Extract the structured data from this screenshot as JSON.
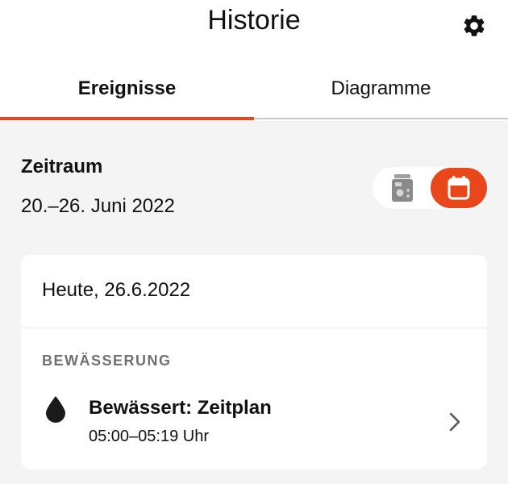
{
  "header": {
    "title": "Historie",
    "settings_icon": "gear-icon"
  },
  "tabs": [
    {
      "label": "Ereignisse",
      "active": true
    },
    {
      "label": "Diagramme",
      "active": false
    }
  ],
  "period": {
    "label": "Zeitraum",
    "range": "20.–26. Juni 2022",
    "toggle": {
      "options": [
        {
          "icon": "device-icon",
          "selected": false
        },
        {
          "icon": "calendar-icon",
          "selected": true
        }
      ]
    }
  },
  "day_card": {
    "date": "Heute, 26.6.2022",
    "section": "BEWÄSSERUNG",
    "event": {
      "icon": "water-drop-icon",
      "title": "Bewässert: Zeitplan",
      "time": "05:00–05:19 Uhr"
    }
  },
  "colors": {
    "accent": "#e8471b",
    "background": "#f4f4f4",
    "card": "#ffffff",
    "section_text": "#707070"
  }
}
